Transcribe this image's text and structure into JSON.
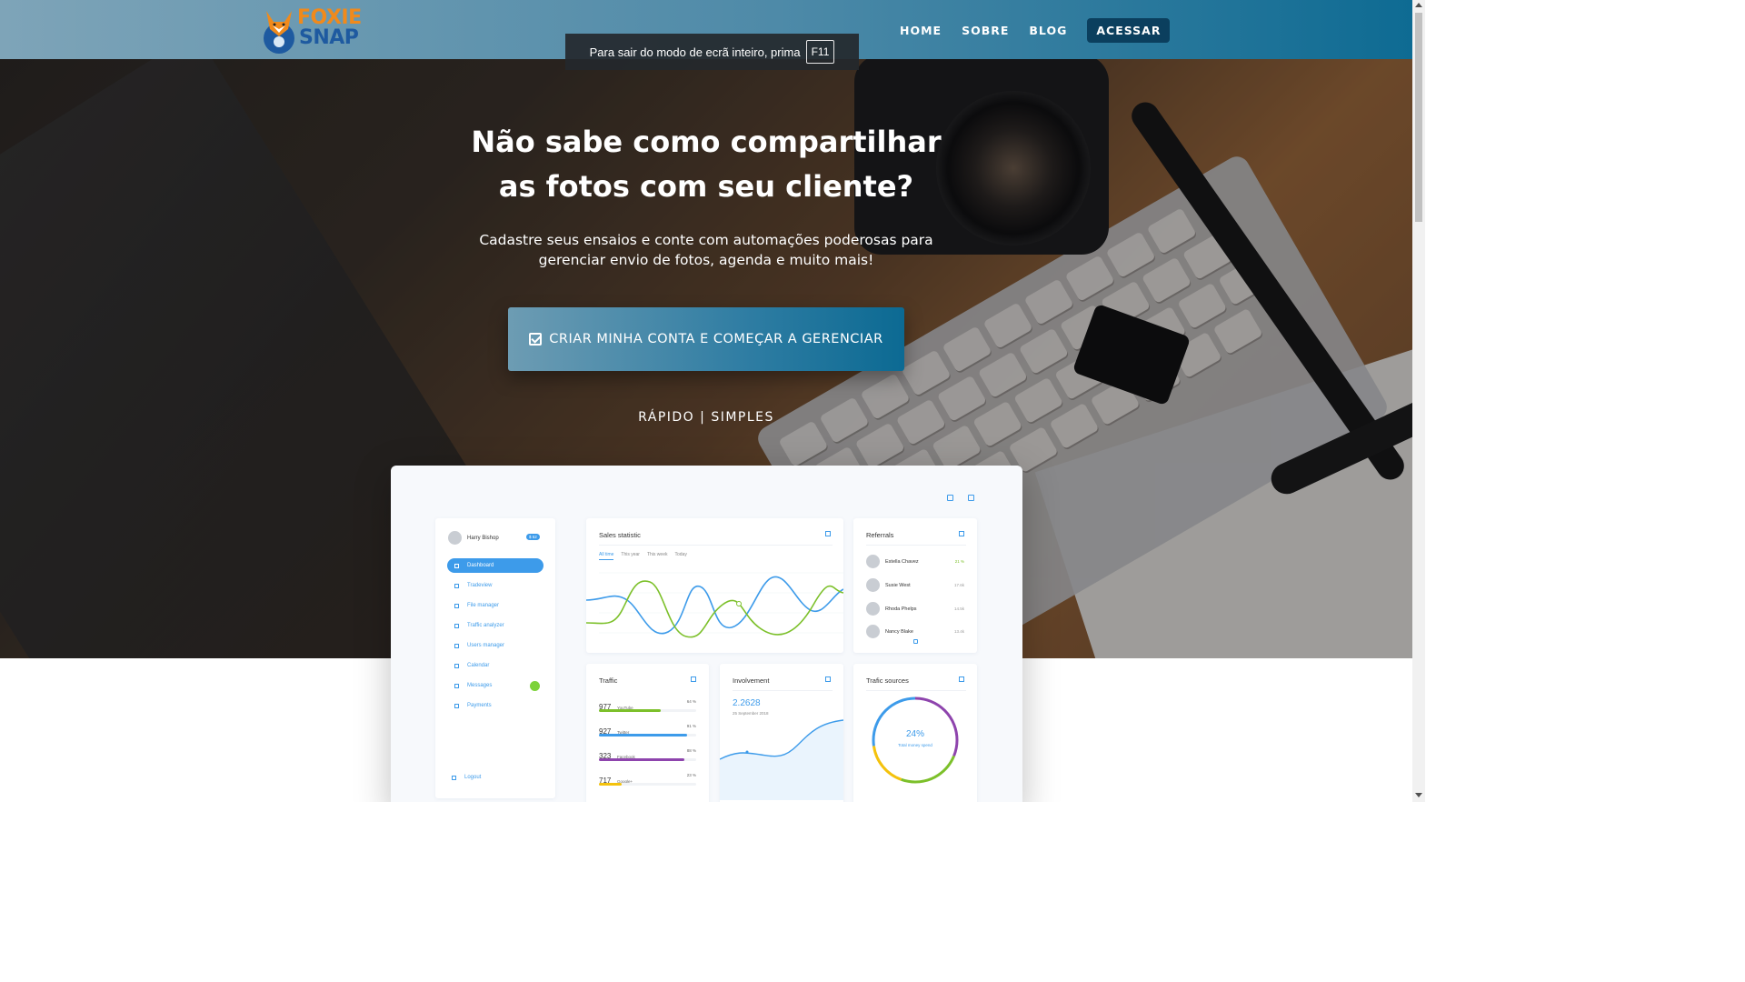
{
  "brand": {
    "line1": "FOXIE",
    "line2": "SNAP"
  },
  "nav": {
    "home": "HOME",
    "about": "SOBRE",
    "blog": "BLOG",
    "login": "ACESSAR"
  },
  "fullscreen_notice": {
    "text": "Para sair do modo de ecrã inteiro, prima",
    "key": "F11"
  },
  "hero": {
    "headline_line1": "Não sabe como compartilhar",
    "headline_line2": "as fotos com seu cliente?",
    "sub_line1": "Cadastre seus ensaios e conte com automações poderosas para",
    "sub_line2": "gerenciar envio de fotos, agenda e muito mais!",
    "cta_label": "CRIAR MINHA CONTA E COMEÇAR A GERENCIAR",
    "tagline": "RÁPIDO | SIMPLES"
  },
  "dashboard": {
    "user": {
      "name": "Harry Bishop",
      "badge": "$ 52"
    },
    "menu": [
      "Dashboard",
      "Tradeview",
      "File manager",
      "Traffic analyzer",
      "Users manager",
      "Calendar",
      "Messages",
      "Payments"
    ],
    "messages_count": "2",
    "logout": "Logout",
    "sales": {
      "title": "Sales statistic",
      "tabs": [
        "All time",
        "This year",
        "This week",
        "Today"
      ]
    },
    "referrals": {
      "title": "Referrals",
      "rows": [
        {
          "name": "Estella Chavez",
          "value": "21 %"
        },
        {
          "name": "Susie West",
          "value": "17.6k"
        },
        {
          "name": "Rhoda Phelps",
          "value": "14.5k"
        },
        {
          "name": "Nancy Blake",
          "value": "13.4k"
        }
      ]
    },
    "traffic": {
      "title": "Traffic",
      "rows": [
        {
          "count": "977",
          "source": "YouTube",
          "pct": "64 %",
          "level": 0.64,
          "color": "#7cc02a"
        },
        {
          "count": "927",
          "source": "Twitter",
          "pct": "91 %",
          "level": 0.91,
          "color": "#3d9bea"
        },
        {
          "count": "323",
          "source": "Facebook",
          "pct": "88 %",
          "level": 0.88,
          "color": "#8e44ad"
        },
        {
          "count": "717",
          "source": "Google+",
          "pct": "23 %",
          "level": 0.23,
          "color": "#f4c20d"
        }
      ]
    },
    "involvement": {
      "title": "Involvement",
      "value": "2.2628",
      "date": "25 September 2018"
    },
    "traffic_sources": {
      "title": "Trafic sources",
      "percent": "24%",
      "caption": "Total money spend"
    }
  }
}
